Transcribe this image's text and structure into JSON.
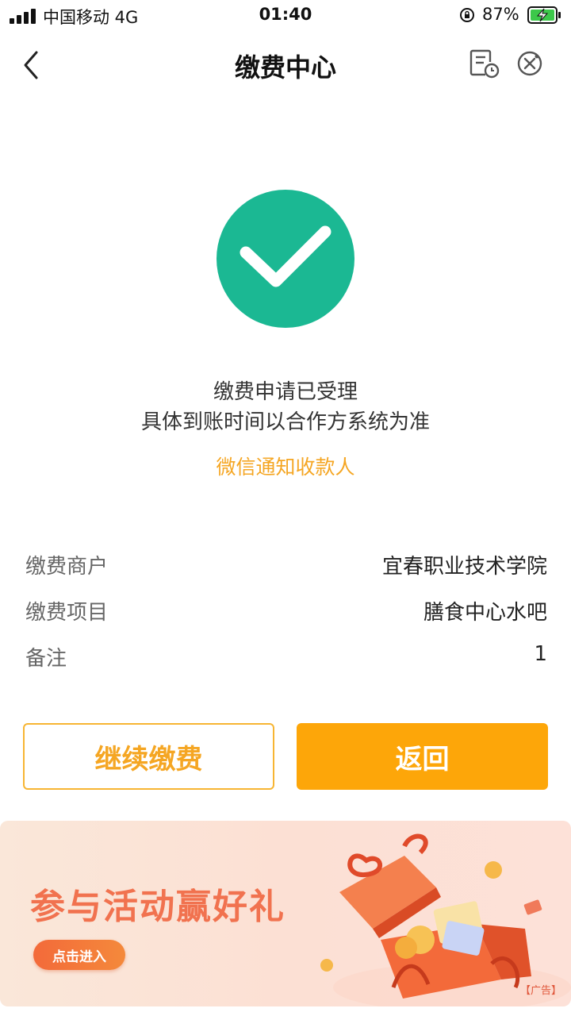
{
  "status_bar": {
    "carrier": "中国移动  4G",
    "time": "01:40",
    "battery_percent": "87%",
    "icons": [
      "signal-icon",
      "rotation-lock-icon",
      "battery-charging-icon"
    ]
  },
  "nav": {
    "title": "缴费中心",
    "icons": [
      "back-icon",
      "payment-record-icon",
      "close-icon"
    ]
  },
  "result": {
    "icon": "check-circle-icon",
    "status_color": "#1bb893",
    "message_line1": "缴费申请已受理",
    "message_line2": "具体到账时间以合作方系统为准",
    "notify_link": "微信通知收款人"
  },
  "details": [
    {
      "label": "缴费商户",
      "value": "宜春职业技术学院"
    },
    {
      "label": "缴费项目",
      "value": "膳食中心水吧"
    },
    {
      "label": "备注",
      "value": "1"
    }
  ],
  "actions": {
    "continue_label": "继续缴费",
    "return_label": "返回",
    "accent_color": "#fda609"
  },
  "banner": {
    "title": "参与活动赢好礼",
    "button_label": "点击进入",
    "ad_label": "【广告】"
  }
}
